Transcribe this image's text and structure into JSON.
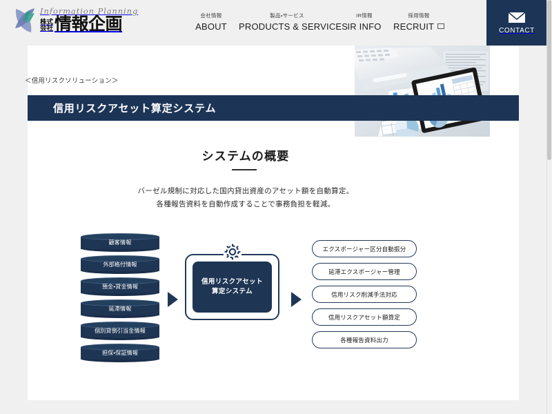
{
  "header": {
    "logo": {
      "mark": "swoosh-leaf-logo",
      "en": "Information Planning",
      "prefix": "株式\n会社",
      "prefix_line1": "株式",
      "prefix_line2": "会社",
      "ja": "情報企画"
    },
    "nav": [
      {
        "ja": "会社情報",
        "en": "ABOUT",
        "external": false
      },
      {
        "ja": "製品・サービス",
        "en": "PRODUCTS & SERVICES",
        "external": false
      },
      {
        "ja": "IR情報",
        "en": "IR INFO",
        "external": false
      },
      {
        "ja": "採用情報",
        "en": "RECRUIT",
        "external": true
      }
    ],
    "contact": {
      "label": "CONTACT",
      "icon": "envelope-icon"
    }
  },
  "breadcrumb": "＜信用リスクソリューション＞",
  "page_title": "信用リスクアセット算定システム",
  "section": {
    "heading": "システムの概要",
    "lead_line1": "バーゼル規制に対応した国内貸出資産のアセット額を自動算定。",
    "lead_line2": "各種報告資料を自動作成することで事務負担を軽減。"
  },
  "diagram": {
    "inputs": [
      "顧客情報",
      "外部格付情報",
      "預金・貸金情報",
      "延滞情報",
      "個別貸倒引当金情報",
      "担保・保証情報"
    ],
    "system": {
      "icon": "gear-icon",
      "line1": "信用リスクアセット",
      "line2": "算定システム"
    },
    "outputs": [
      "エクスポージャー区分自動振分",
      "延滞エクスポージャー管理",
      "信用リスク削減手法対応",
      "信用リスクアセット額算定",
      "各種報告資料出力"
    ],
    "arrow_left": "arrow-right-icon",
    "arrow_right": "arrow-right-icon"
  },
  "hero": {
    "alt": "tablet-with-charts-photo"
  },
  "colors": {
    "navy": "#1c3557",
    "page_bg": "#f0f0f0",
    "sheet_bg": "#ffffff",
    "text": "#1a1a1a"
  }
}
